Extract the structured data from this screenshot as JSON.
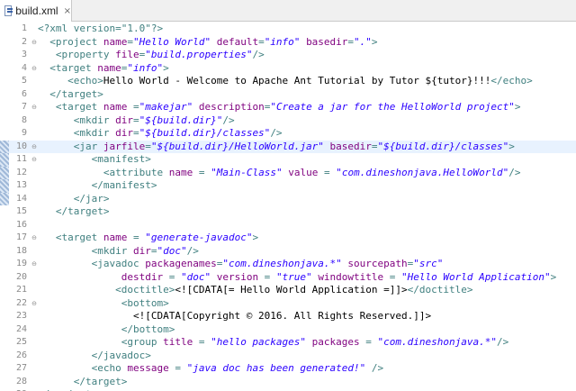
{
  "tab": {
    "title": "build.xml",
    "close_icon": "×"
  },
  "lines": [
    {
      "num": "1",
      "indent": 0,
      "parts": [
        [
          "decl",
          "<?xml version=\"1.0\"?>"
        ]
      ]
    },
    {
      "num": "2",
      "indent": 2,
      "fold": "⊖",
      "parts": [
        [
          "tag",
          "<project "
        ],
        [
          "attr",
          "name"
        ],
        [
          "tag",
          "="
        ],
        [
          "val",
          "\"Hello World\""
        ],
        [
          "tag",
          " "
        ],
        [
          "attr",
          "default"
        ],
        [
          "tag",
          "="
        ],
        [
          "val",
          "\"info\""
        ],
        [
          "tag",
          " "
        ],
        [
          "attr",
          "basedir"
        ],
        [
          "tag",
          "="
        ],
        [
          "val",
          "\".\""
        ],
        [
          "tag",
          ">"
        ]
      ]
    },
    {
      "num": "3",
      "indent": 3,
      "parts": [
        [
          "tag",
          "<property "
        ],
        [
          "attr",
          "file"
        ],
        [
          "tag",
          "="
        ],
        [
          "val",
          "\"build.properties\""
        ],
        [
          "tag",
          "/>"
        ]
      ]
    },
    {
      "num": "4",
      "indent": 2,
      "fold": "⊖",
      "parts": [
        [
          "tag",
          "<target "
        ],
        [
          "attr",
          "name"
        ],
        [
          "tag",
          "="
        ],
        [
          "val",
          "\"info\""
        ],
        [
          "tag",
          ">"
        ]
      ]
    },
    {
      "num": "5",
      "indent": 5,
      "parts": [
        [
          "tag",
          "<echo>"
        ],
        [
          "content",
          "Hello World - Welcome to Apache Ant Tutorial by Tutor ${tutor}!!!"
        ],
        [
          "tag",
          "</echo>"
        ]
      ]
    },
    {
      "num": "6",
      "indent": 2,
      "parts": [
        [
          "tag",
          "</target>"
        ]
      ]
    },
    {
      "num": "7",
      "indent": 3,
      "fold": "⊖",
      "parts": [
        [
          "tag",
          "<target "
        ],
        [
          "attr",
          "name"
        ],
        [
          "tag",
          " ="
        ],
        [
          "val",
          "\"makejar\""
        ],
        [
          "tag",
          " "
        ],
        [
          "attr",
          "description"
        ],
        [
          "tag",
          "="
        ],
        [
          "val",
          "\"Create a jar for the HelloWorld project\""
        ],
        [
          "tag",
          ">"
        ]
      ]
    },
    {
      "num": "8",
      "indent": 6,
      "parts": [
        [
          "tag",
          "<mkdir "
        ],
        [
          "attr",
          "dir"
        ],
        [
          "tag",
          "="
        ],
        [
          "val",
          "\"${build.dir}\""
        ],
        [
          "tag",
          "/>"
        ]
      ]
    },
    {
      "num": "9",
      "indent": 6,
      "parts": [
        [
          "tag",
          "<mkdir "
        ],
        [
          "attr",
          "dir"
        ],
        [
          "tag",
          "="
        ],
        [
          "val",
          "\"${build.dir}/classes\""
        ],
        [
          "tag",
          "/>"
        ]
      ]
    },
    {
      "num": "10",
      "indent": 6,
      "fold": "⊖",
      "changed": true,
      "current": true,
      "parts": [
        [
          "tag",
          "<jar "
        ],
        [
          "attr",
          "jarfile"
        ],
        [
          "tag",
          "="
        ],
        [
          "val",
          "\"${build.dir}/HelloWorld.jar\""
        ],
        [
          "tag",
          " "
        ],
        [
          "attr",
          "basedir"
        ],
        [
          "tag",
          "="
        ],
        [
          "val",
          "\"${build.dir}/classes\""
        ],
        [
          "tag",
          ">"
        ]
      ]
    },
    {
      "num": "11",
      "indent": 9,
      "fold": "⊖",
      "changed": true,
      "parts": [
        [
          "tag",
          "<manifest>"
        ]
      ]
    },
    {
      "num": "12",
      "indent": 11,
      "changed": true,
      "parts": [
        [
          "tag",
          "<attribute "
        ],
        [
          "attr",
          "name"
        ],
        [
          "tag",
          " = "
        ],
        [
          "val",
          "\"Main-Class\""
        ],
        [
          "tag",
          " "
        ],
        [
          "attr",
          "value"
        ],
        [
          "tag",
          " = "
        ],
        [
          "val",
          "\"com.dineshonjava.HelloWorld\""
        ],
        [
          "tag",
          "/>"
        ]
      ]
    },
    {
      "num": "13",
      "indent": 9,
      "changed": true,
      "parts": [
        [
          "tag",
          "</manifest>"
        ]
      ]
    },
    {
      "num": "14",
      "indent": 6,
      "changed": true,
      "parts": [
        [
          "tag",
          "</jar>"
        ]
      ]
    },
    {
      "num": "15",
      "indent": 3,
      "parts": [
        [
          "tag",
          "</target>"
        ]
      ]
    },
    {
      "num": "16",
      "indent": 0,
      "parts": []
    },
    {
      "num": "17",
      "indent": 3,
      "fold": "⊖",
      "parts": [
        [
          "tag",
          "<target "
        ],
        [
          "attr",
          "name"
        ],
        [
          "tag",
          " = "
        ],
        [
          "val",
          "\"generate-javadoc\""
        ],
        [
          "tag",
          ">"
        ]
      ]
    },
    {
      "num": "18",
      "indent": 9,
      "parts": [
        [
          "tag",
          "<mkdir "
        ],
        [
          "attr",
          "dir"
        ],
        [
          "tag",
          "="
        ],
        [
          "val",
          "\"doc\""
        ],
        [
          "tag",
          "/>"
        ]
      ]
    },
    {
      "num": "19",
      "indent": 9,
      "fold": "⊖",
      "parts": [
        [
          "tag",
          "<javadoc "
        ],
        [
          "attr",
          "packagenames"
        ],
        [
          "tag",
          "="
        ],
        [
          "val",
          "\"com.dineshonjava.*\""
        ],
        [
          "tag",
          " "
        ],
        [
          "attr",
          "sourcepath"
        ],
        [
          "tag",
          "="
        ],
        [
          "val",
          "\"src\""
        ]
      ]
    },
    {
      "num": "20",
      "indent": 14,
      "parts": [
        [
          "attr",
          "destdir"
        ],
        [
          "tag",
          " = "
        ],
        [
          "val",
          "\"doc\""
        ],
        [
          "tag",
          " "
        ],
        [
          "attr",
          "version"
        ],
        [
          "tag",
          " = "
        ],
        [
          "val",
          "\"true\""
        ],
        [
          "tag",
          " "
        ],
        [
          "attr",
          "windowtitle"
        ],
        [
          "tag",
          " = "
        ],
        [
          "val",
          "\"Hello World Application\""
        ],
        [
          "tag",
          ">"
        ]
      ]
    },
    {
      "num": "21",
      "indent": 13,
      "parts": [
        [
          "tag",
          "<doctitle>"
        ],
        [
          "content",
          "<![CDATA[= Hello World Application =]]>"
        ],
        [
          "tag",
          "</doctitle>"
        ]
      ]
    },
    {
      "num": "22",
      "indent": 14,
      "fold": "⊖",
      "parts": [
        [
          "tag",
          "<bottom>"
        ]
      ]
    },
    {
      "num": "23",
      "indent": 16,
      "parts": [
        [
          "content",
          "<![CDATA[Copyright © 2016. All Rights Reserved.]]>"
        ]
      ]
    },
    {
      "num": "24",
      "indent": 14,
      "parts": [
        [
          "tag",
          "</bottom>"
        ]
      ]
    },
    {
      "num": "25",
      "indent": 14,
      "parts": [
        [
          "tag",
          "<group "
        ],
        [
          "attr",
          "title"
        ],
        [
          "tag",
          " = "
        ],
        [
          "val",
          "\"hello packages\""
        ],
        [
          "tag",
          " "
        ],
        [
          "attr",
          "packages"
        ],
        [
          "tag",
          " = "
        ],
        [
          "val",
          "\"com.dineshonjava.*\""
        ],
        [
          "tag",
          "/>"
        ]
      ]
    },
    {
      "num": "26",
      "indent": 9,
      "parts": [
        [
          "tag",
          "</javadoc>"
        ]
      ]
    },
    {
      "num": "27",
      "indent": 9,
      "parts": [
        [
          "tag",
          "<echo "
        ],
        [
          "attr",
          "message"
        ],
        [
          "tag",
          " = "
        ],
        [
          "val",
          "\"java doc has been generated!\""
        ],
        [
          "tag",
          " />"
        ]
      ]
    },
    {
      "num": "28",
      "indent": 6,
      "parts": [
        [
          "tag",
          "</target>"
        ]
      ]
    },
    {
      "num": "29",
      "indent": 0,
      "parts": [
        [
          "tag",
          "</project>"
        ]
      ]
    }
  ]
}
